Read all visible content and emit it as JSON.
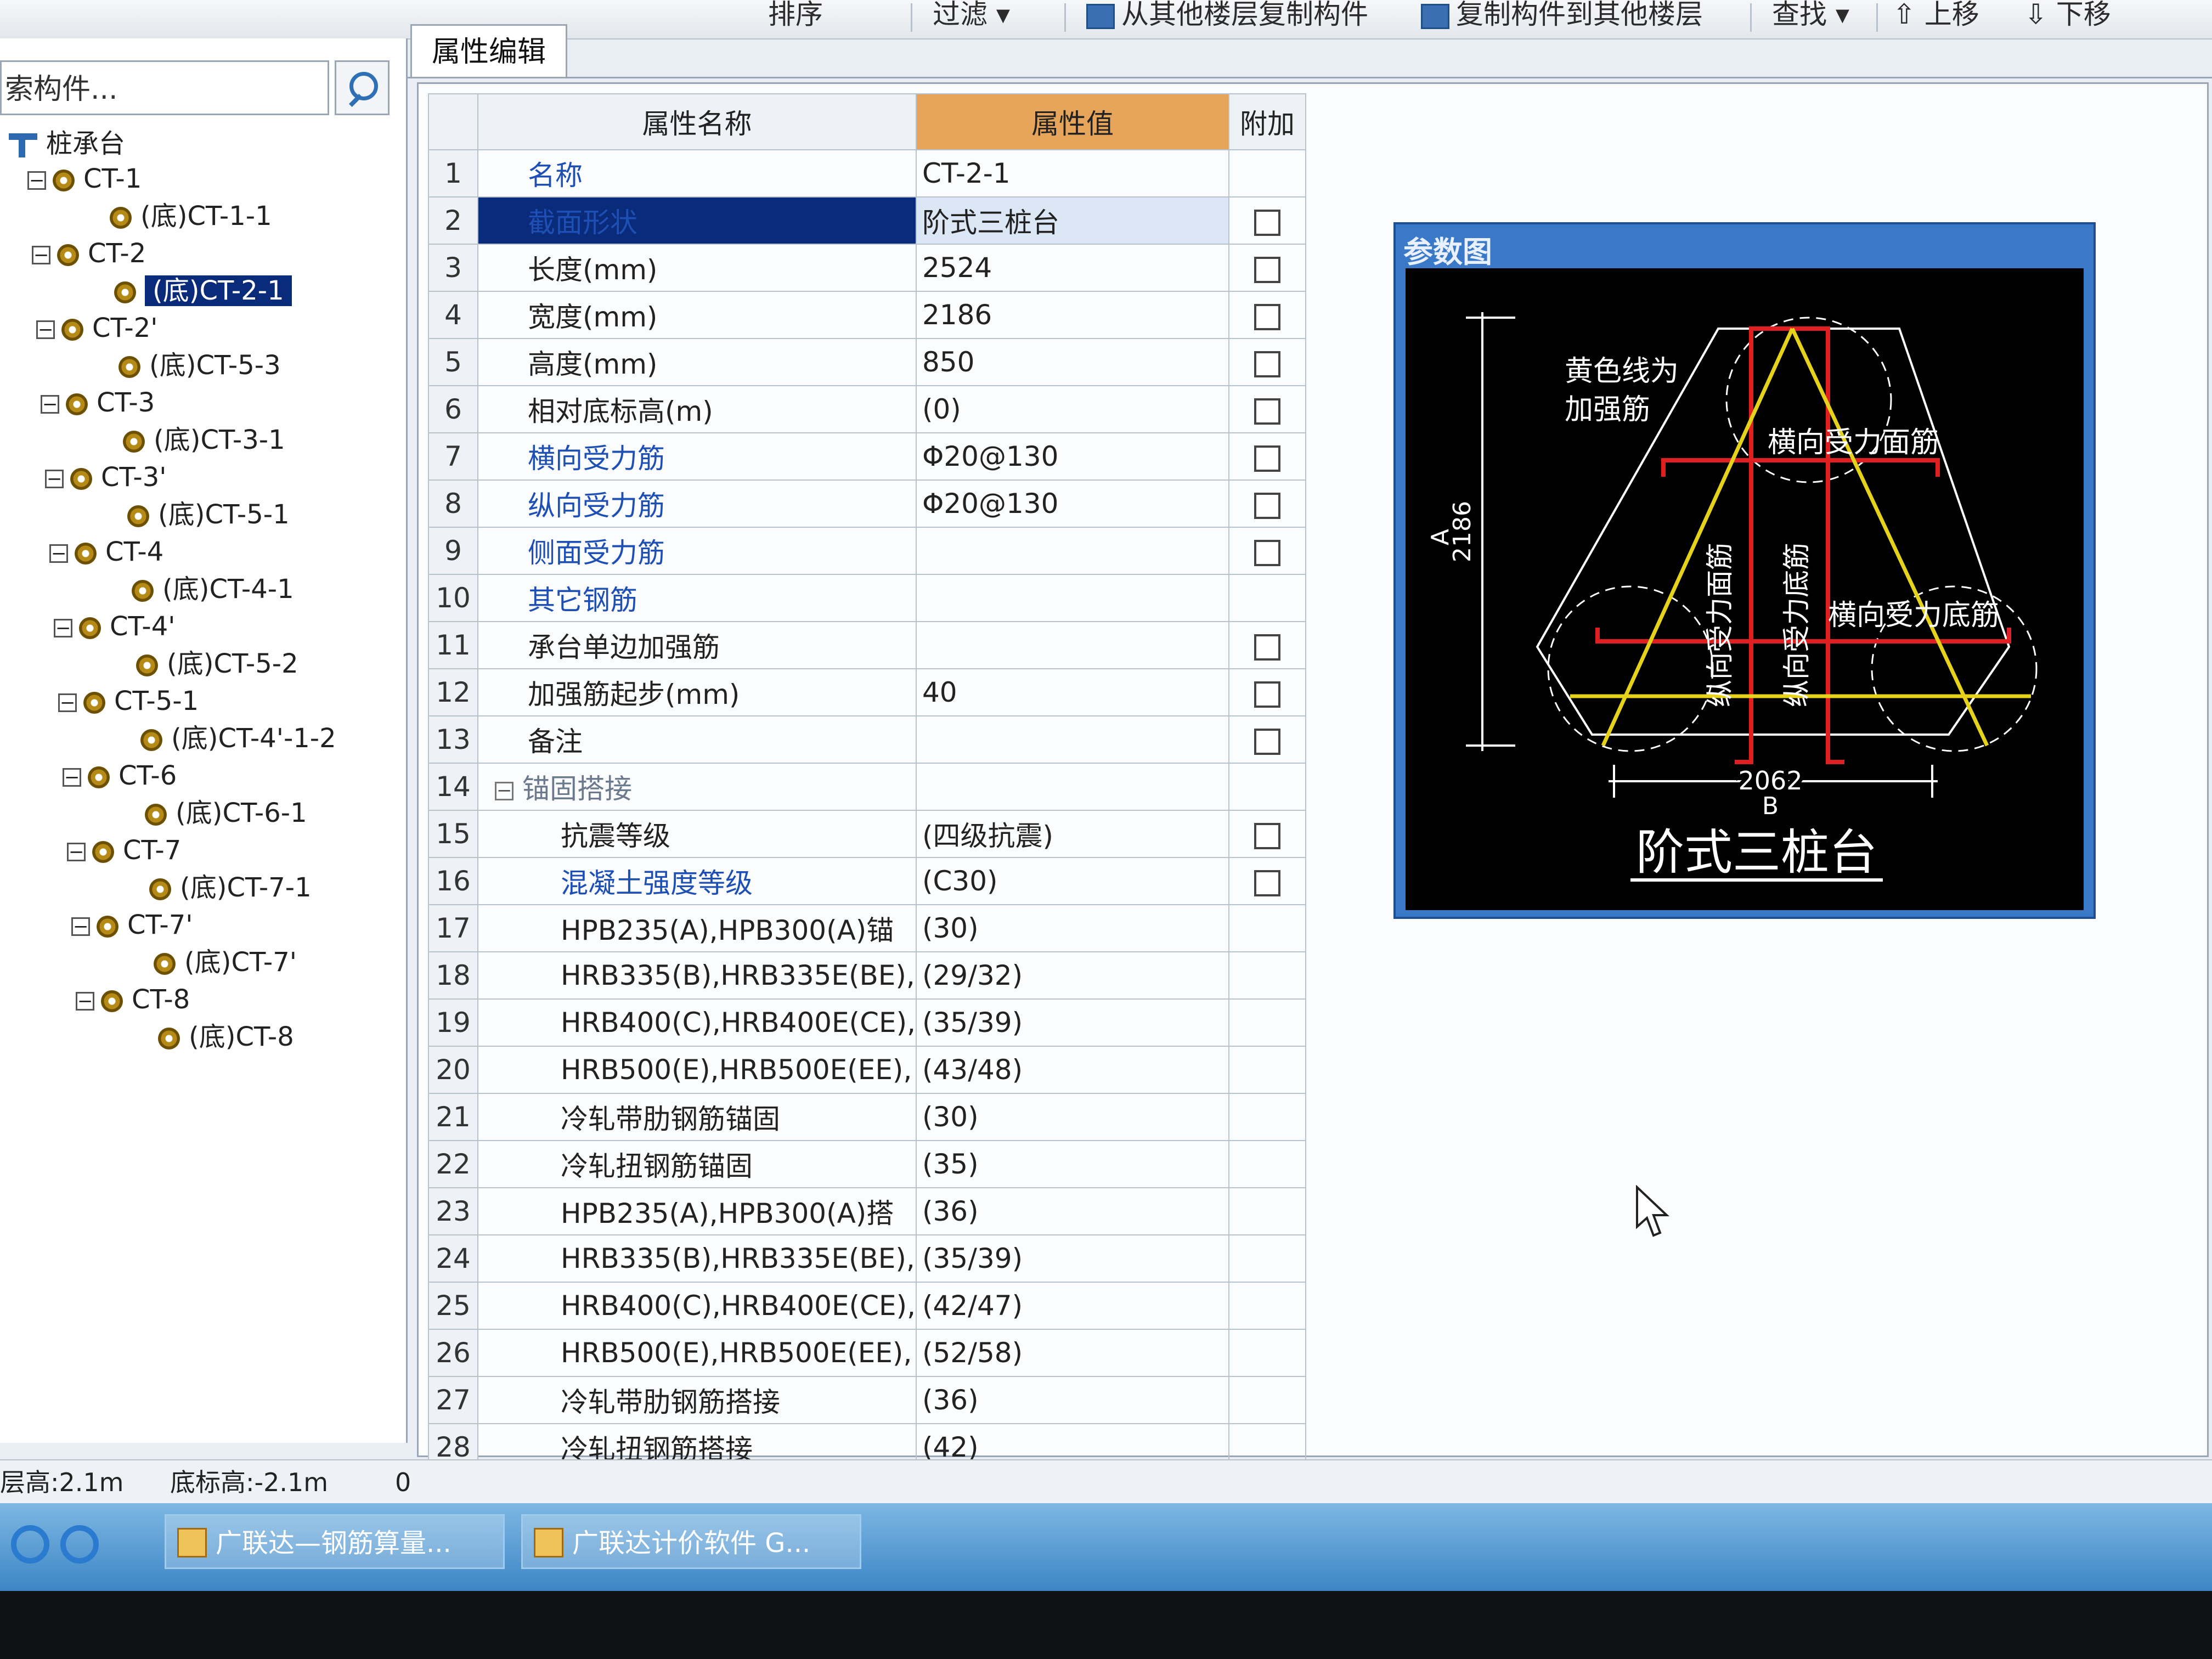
{
  "toolbar": {
    "sort_label": "排序",
    "filter_label": "过滤",
    "copy_from_label": "从其他楼层复制构件",
    "copy_to_label": "复制构件到其他楼层",
    "find_label": "查找",
    "move_up_label": "上移",
    "move_down_label": "下移"
  },
  "left": {
    "search_text": "索构件...",
    "root_label": "桩承台",
    "nodes": [
      {
        "label": "CT-1",
        "child": "(底)CT-1-1"
      },
      {
        "label": "CT-2",
        "child": "(底)CT-2-1"
      },
      {
        "label": "CT-2'",
        "child": "(底)CT-5-3"
      },
      {
        "label": "CT-3",
        "child": "(底)CT-3-1"
      },
      {
        "label": "CT-3'",
        "child": "(底)CT-5-1"
      },
      {
        "label": "CT-4",
        "child": "(底)CT-4-1"
      },
      {
        "label": "CT-4'",
        "child": "(底)CT-5-2"
      },
      {
        "label": "CT-5-1",
        "child": "(底)CT-4'-1-2"
      },
      {
        "label": "CT-6",
        "child": "(底)CT-6-1"
      },
      {
        "label": "CT-7",
        "child": "(底)CT-7-1"
      },
      {
        "label": "CT-7'",
        "child": "(底)CT-7'"
      },
      {
        "label": "CT-8",
        "child": "(底)CT-8"
      }
    ]
  },
  "tab_label": "属性编辑",
  "table": {
    "col_name": "属性名称",
    "col_value": "属性值",
    "col_add": "附加",
    "rows": [
      {
        "n": "1",
        "name": "名称",
        "value": "CT-2-1"
      },
      {
        "n": "2",
        "name": "截面形状",
        "value": "阶式三桩台"
      },
      {
        "n": "3",
        "name": "长度(mm)",
        "value": "2524"
      },
      {
        "n": "4",
        "name": "宽度(mm)",
        "value": "2186"
      },
      {
        "n": "5",
        "name": "高度(mm)",
        "value": "850"
      },
      {
        "n": "6",
        "name": "相对底标高(m)",
        "value": "(0)"
      },
      {
        "n": "7",
        "name": "横向受力筋",
        "value": "Φ20@130"
      },
      {
        "n": "8",
        "name": "纵向受力筋",
        "value": "Φ20@130"
      },
      {
        "n": "9",
        "name": "侧面受力筋",
        "value": ""
      },
      {
        "n": "10",
        "name": "其它钢筋",
        "value": ""
      },
      {
        "n": "11",
        "name": "承台单边加强筋",
        "value": ""
      },
      {
        "n": "12",
        "name": "加强筋起步(mm)",
        "value": "40"
      },
      {
        "n": "13",
        "name": "备注",
        "value": ""
      },
      {
        "n": "14",
        "name": "锚固搭接",
        "value": ""
      },
      {
        "n": "15",
        "name": "抗震等级",
        "value": "(四级抗震)"
      },
      {
        "n": "16",
        "name": "混凝土强度等级",
        "value": "(C30)"
      },
      {
        "n": "17",
        "name": "HPB235(A),HPB300(A)锚",
        "value": "(30)"
      },
      {
        "n": "18",
        "name": "HRB335(B),HRB335E(BE),",
        "value": "(29/32)"
      },
      {
        "n": "19",
        "name": "HRB400(C),HRB400E(CE),",
        "value": "(35/39)"
      },
      {
        "n": "20",
        "name": "HRB500(E),HRB500E(EE),",
        "value": "(43/48)"
      },
      {
        "n": "21",
        "name": "冷轧带肋钢筋锚固",
        "value": "(30)"
      },
      {
        "n": "22",
        "name": "冷轧扭钢筋锚固",
        "value": "(35)"
      },
      {
        "n": "23",
        "name": "HPB235(A),HPB300(A)搭",
        "value": "(36)"
      },
      {
        "n": "24",
        "name": "HRB335(B),HRB335E(BE),",
        "value": "(35/39)"
      },
      {
        "n": "25",
        "name": "HRB400(C),HRB400E(CE),",
        "value": "(42/47)"
      },
      {
        "n": "26",
        "name": "HRB500(E),HRB500E(EE),",
        "value": "(52/58)"
      },
      {
        "n": "27",
        "name": "冷轧带肋钢筋搭接",
        "value": "(36)"
      },
      {
        "n": "28",
        "name": "冷轧扭钢筋搭接",
        "value": "(42)"
      }
    ]
  },
  "diagram": {
    "title": "参数图",
    "yellow_note_1": "黄色线为",
    "yellow_note_2": "加强筋",
    "label_top": "横向受力面筋",
    "label_bottom": "横向受力底筋",
    "label_v1": "纵向受力面筋",
    "label_v2": "纵向受力底筋",
    "dim_a_value": "2186",
    "dim_a_letter": "A",
    "dim_b_value": "2062",
    "dim_b_letter": "B",
    "shape_name": "阶式三桩台"
  },
  "status": {
    "floor_height": "层高:2.1m",
    "bottom_elev": "底标高:-2.1m",
    "extra": "0"
  },
  "taskbar": {
    "app1": "广联达—钢筋算量...",
    "app2": "广联达计价软件 G..."
  },
  "colors": {
    "selection": "#0a2a7a",
    "header_accent": "#e6a55a",
    "link_blue": "#1d4fb4",
    "rebar_red": "#e02020",
    "rebar_yellow": "#e6d21a"
  }
}
